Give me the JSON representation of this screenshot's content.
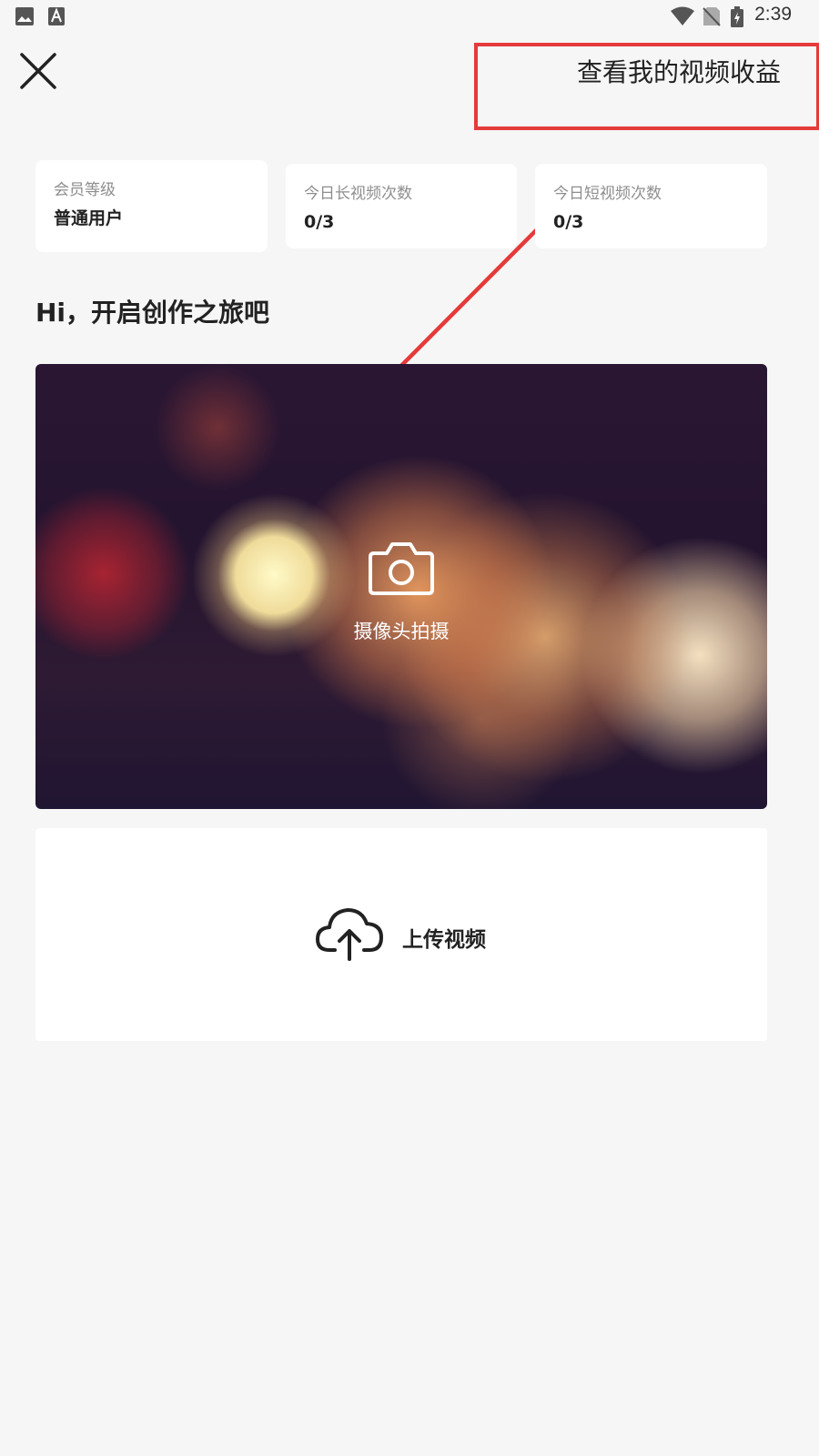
{
  "status_bar": {
    "time": "2:39",
    "icons": [
      "gallery-icon",
      "font-a-icon",
      "wifi-icon",
      "no-sim-icon",
      "battery-charging-icon"
    ]
  },
  "header": {
    "close_icon": "close-icon",
    "earnings_link": "查看我的视频收益"
  },
  "stats": [
    {
      "label": "会员等级",
      "value": "普通用户"
    },
    {
      "label": "今日长视频次数",
      "value": "0/3"
    },
    {
      "label": "今日短视频次数",
      "value": "0/3"
    }
  ],
  "greeting": "Hi，开启创作之旅吧",
  "camera": {
    "icon": "camera-icon",
    "label": "摄像头拍摄"
  },
  "upload": {
    "icon": "cloud-upload-icon",
    "label": "上传视频"
  },
  "colors": {
    "annotation": "#e53a3a",
    "background": "#f5f6f5",
    "card": "#ffffff"
  }
}
